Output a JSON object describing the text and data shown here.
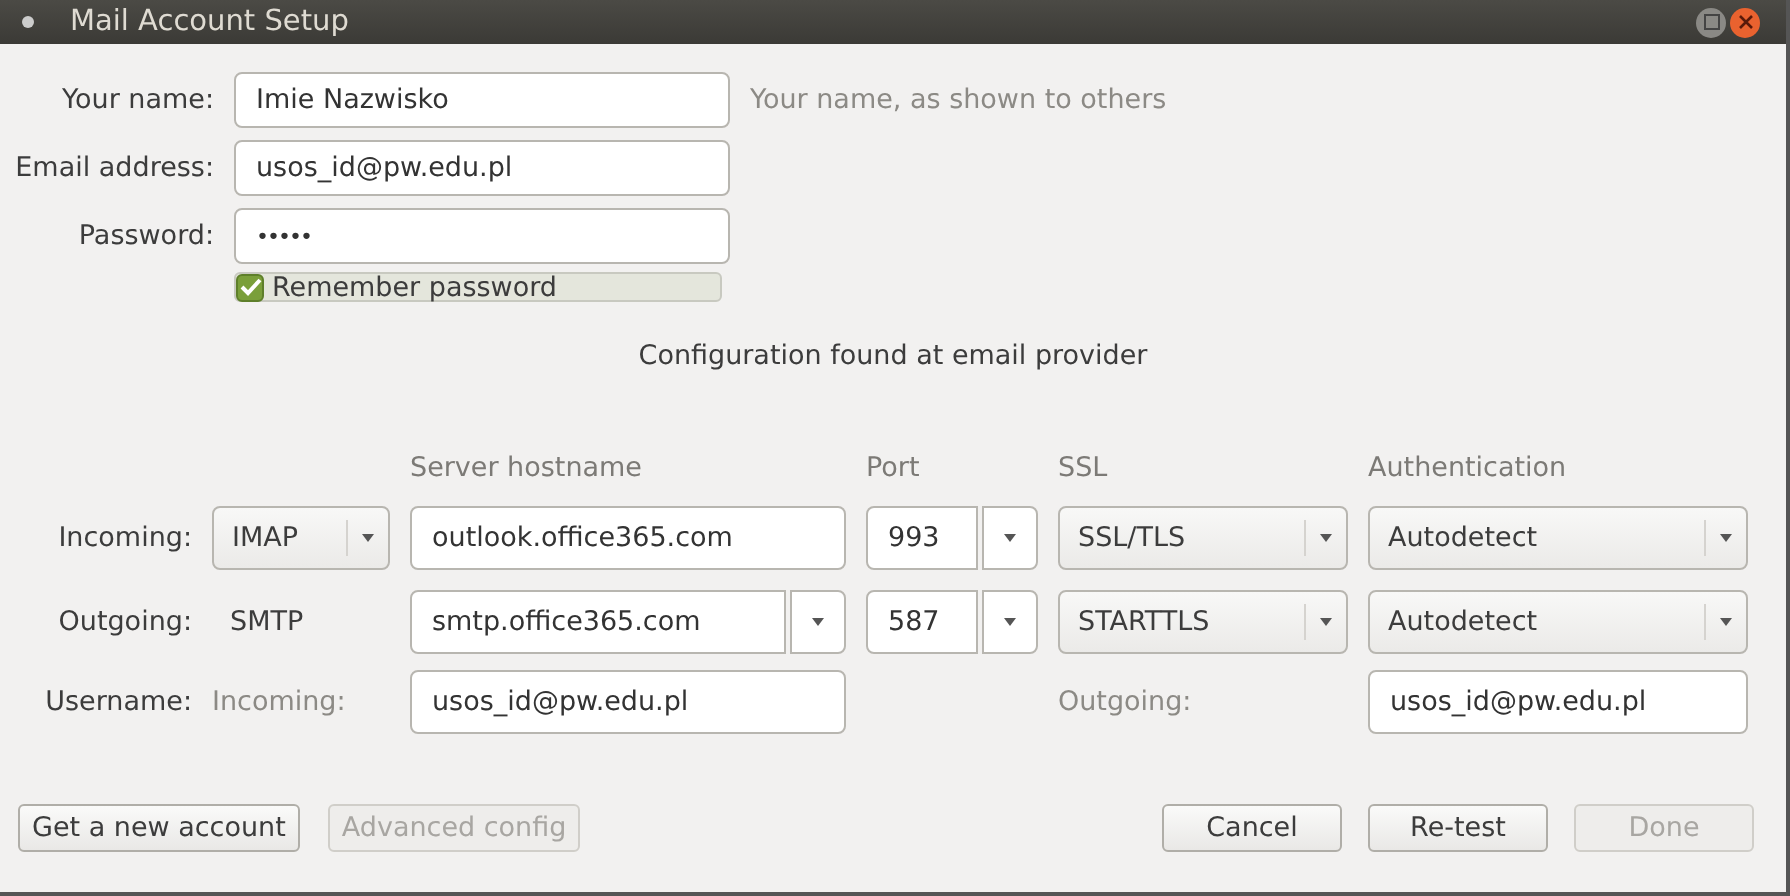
{
  "window": {
    "title": "Mail Account Setup"
  },
  "fields": [
    {
      "kind": "text",
      "label": "Your name:",
      "value": "Imie Nazwisko",
      "hint": "Your name, as shown to others"
    },
    {
      "kind": "text",
      "label": "Email address:",
      "value": "usos_id@pw.edu.pl"
    },
    {
      "kind": "password",
      "label": "Password:",
      "value": "•••••"
    }
  ],
  "remember": {
    "label": "Remember password",
    "checked": true
  },
  "status": "Configuration found at email provider",
  "server": {
    "columns": [
      "Server hostname",
      "Port",
      "SSL",
      "Authentication"
    ],
    "rows": [
      {
        "label": "Incoming:",
        "protocol": {
          "kind": "select",
          "value": "IMAP"
        },
        "hostname": {
          "kind": "text",
          "value": "outlook.office365.com"
        },
        "port": "993",
        "ssl": "SSL/TLS",
        "auth": "Autodetect"
      },
      {
        "label": "Outgoing:",
        "protocol": {
          "kind": "text",
          "value": "SMTP"
        },
        "hostname": {
          "kind": "combo",
          "value": "smtp.office365.com"
        },
        "port": "587",
        "ssl": "STARTTLS",
        "auth": "Autodetect"
      }
    ],
    "username": {
      "label": "Username:",
      "incoming_label": "Incoming:",
      "incoming": "usos_id@pw.edu.pl",
      "outgoing_label": "Outgoing:",
      "outgoing": "usos_id@pw.edu.pl"
    }
  },
  "left_buttons": [
    {
      "label": "Get a new account",
      "disabled": false
    },
    {
      "label": "Advanced config",
      "disabled": true
    }
  ],
  "right_buttons": [
    {
      "label": "Cancel",
      "disabled": false
    },
    {
      "label": "Re-test",
      "disabled": false
    },
    {
      "label": "Done",
      "disabled": true
    }
  ]
}
